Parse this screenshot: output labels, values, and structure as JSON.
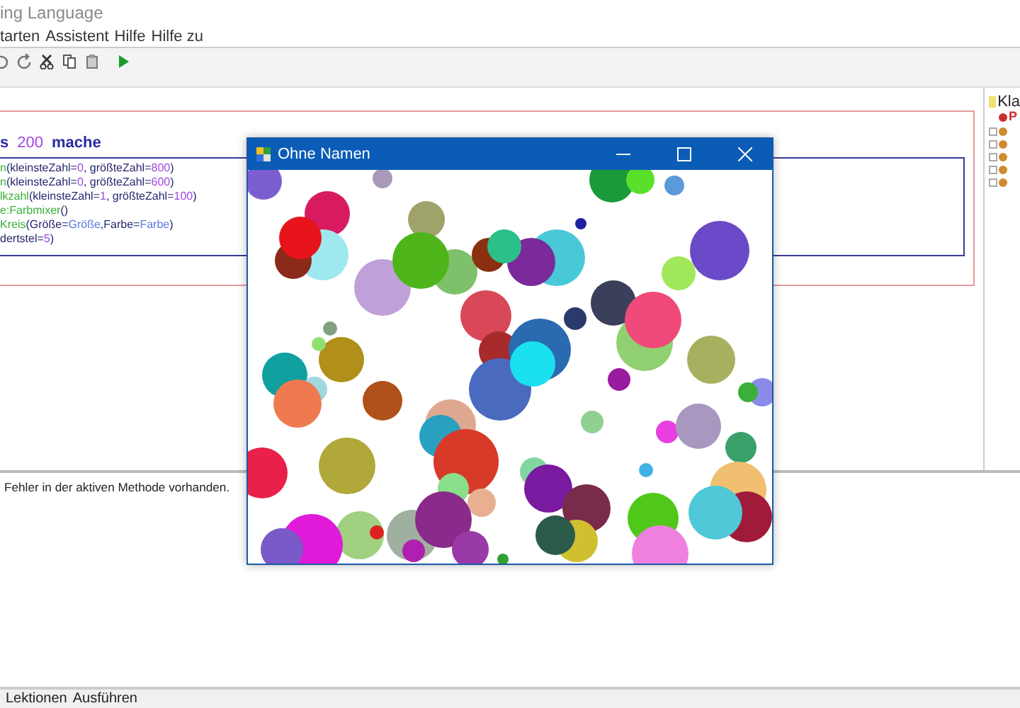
{
  "window": {
    "title": "ing Language"
  },
  "menu": [
    "tarten",
    "Assistent",
    "Hilfe",
    "Hilfe zu"
  ],
  "editor": {
    "header": [
      {
        "kind": "keyword",
        "text": "s"
      },
      {
        "kind": "number",
        "text": "200"
      },
      {
        "kind": "keyword",
        "text": "mache"
      }
    ],
    "lines": [
      [
        {
          "kind": "method",
          "text": "n"
        },
        {
          "kind": "plain",
          "text": "(kleinsteZahl="
        },
        {
          "kind": "number",
          "text": "0"
        },
        {
          "kind": "plain",
          "text": ", größteZahl="
        },
        {
          "kind": "number",
          "text": "800"
        },
        {
          "kind": "plain",
          "text": ")"
        }
      ],
      [
        {
          "kind": "method",
          "text": "n"
        },
        {
          "kind": "plain",
          "text": "(kleinsteZahl="
        },
        {
          "kind": "number",
          "text": "0"
        },
        {
          "kind": "plain",
          "text": ", größteZahl="
        },
        {
          "kind": "number",
          "text": "600"
        },
        {
          "kind": "plain",
          "text": ")"
        }
      ],
      [
        {
          "kind": "method",
          "text": "lkzahl"
        },
        {
          "kind": "plain",
          "text": "(kleinsteZahl="
        },
        {
          "kind": "number",
          "text": "1"
        },
        {
          "kind": "plain",
          "text": ", größteZahl="
        },
        {
          "kind": "number",
          "text": "100"
        },
        {
          "kind": "plain",
          "text": ")"
        }
      ],
      [
        {
          "kind": "method",
          "text": "e:Farbmixer"
        },
        {
          "kind": "plain",
          "text": "()"
        }
      ],
      [
        {
          "kind": "method",
          "text": "Kreis"
        },
        {
          "kind": "plain",
          "text": "(Größe="
        },
        {
          "kind": "param",
          "text": "Größe"
        },
        {
          "kind": "plain",
          "text": ",Farbe="
        },
        {
          "kind": "param",
          "text": "Farbe"
        },
        {
          "kind": "plain",
          "text": ")"
        }
      ],
      [
        {
          "kind": "plain",
          "text": "dertstel="
        },
        {
          "kind": "number",
          "text": "5"
        },
        {
          "kind": "plain",
          "text": ")"
        }
      ]
    ]
  },
  "tree": {
    "title": "Kla",
    "items": [
      "P"
    ]
  },
  "status": "Fehler in der aktiven Methode vorhanden.",
  "bottom_tabs": [
    "Lektionen",
    "Ausführen"
  ],
  "canvas_window": {
    "title": "Ohne Namen"
  }
}
